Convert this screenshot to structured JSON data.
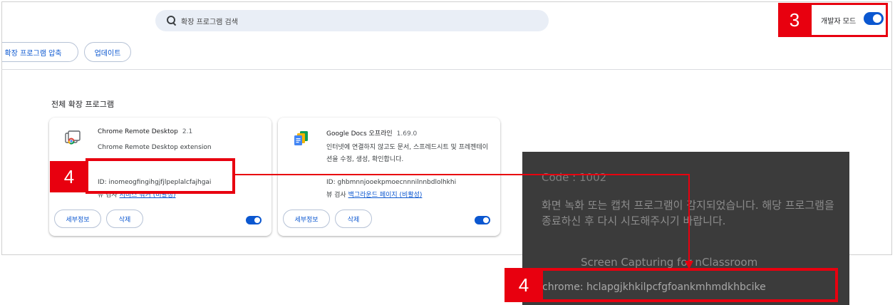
{
  "search": {
    "placeholder": "확장 프로그램 검색"
  },
  "dev_mode": {
    "label": "개발자 모드",
    "enabled": true
  },
  "toolbar": {
    "pack_label": "확장 프로그램 압축",
    "update_label": "업데이트"
  },
  "section": {
    "title": "전체 확장 프로그램"
  },
  "extensions": [
    {
      "name": "Chrome Remote Desktop",
      "version": "2.1",
      "description": "Chrome Remote Desktop extension",
      "id_text": "ID: inomeogfingihgjfjlpeplalcfajhgai",
      "inspect_prefix": "뷰 검사",
      "inspect_link": "서비스 워커 (비활성)",
      "details_label": "세부정보",
      "remove_label": "삭제",
      "enabled": true,
      "icon": "chrome-remote-desktop-icon"
    },
    {
      "name": "Google Docs 오프라인",
      "version": "1.69.0",
      "description": "인터넷에 연결하지 않고도 문서, 스프레드시트 및 프레젠테이션을 수정, 생성, 확인합니다.",
      "id_text": "ID: ghbmnnjooekpmoecnnnilnnbdlolhkhi",
      "inspect_prefix": "뷰 검사",
      "inspect_link": "백그라운드 페이지 (비활성)",
      "details_label": "세부정보",
      "remove_label": "삭제",
      "enabled": true,
      "icon": "google-docs-icon"
    }
  ],
  "annotations": {
    "step3": "3",
    "step4_a": "4",
    "step4_b": "4"
  },
  "dialog": {
    "code": "Code : 1002",
    "message": "화면 녹화 또는 캡처 프로그램이 감지되었습니다. 해당 프로그램을 종료하신 후 다시 시도해주시기 바랍니다.",
    "caption": "Screen Capturing for nClassroom",
    "detected": "chrome: hclapgjkhkilpcfgfoankmhmdkhbcike"
  },
  "colors": {
    "accent": "#0b57d0",
    "annotation": "#e8000f",
    "dialog_bg": "#3b3b3b"
  }
}
